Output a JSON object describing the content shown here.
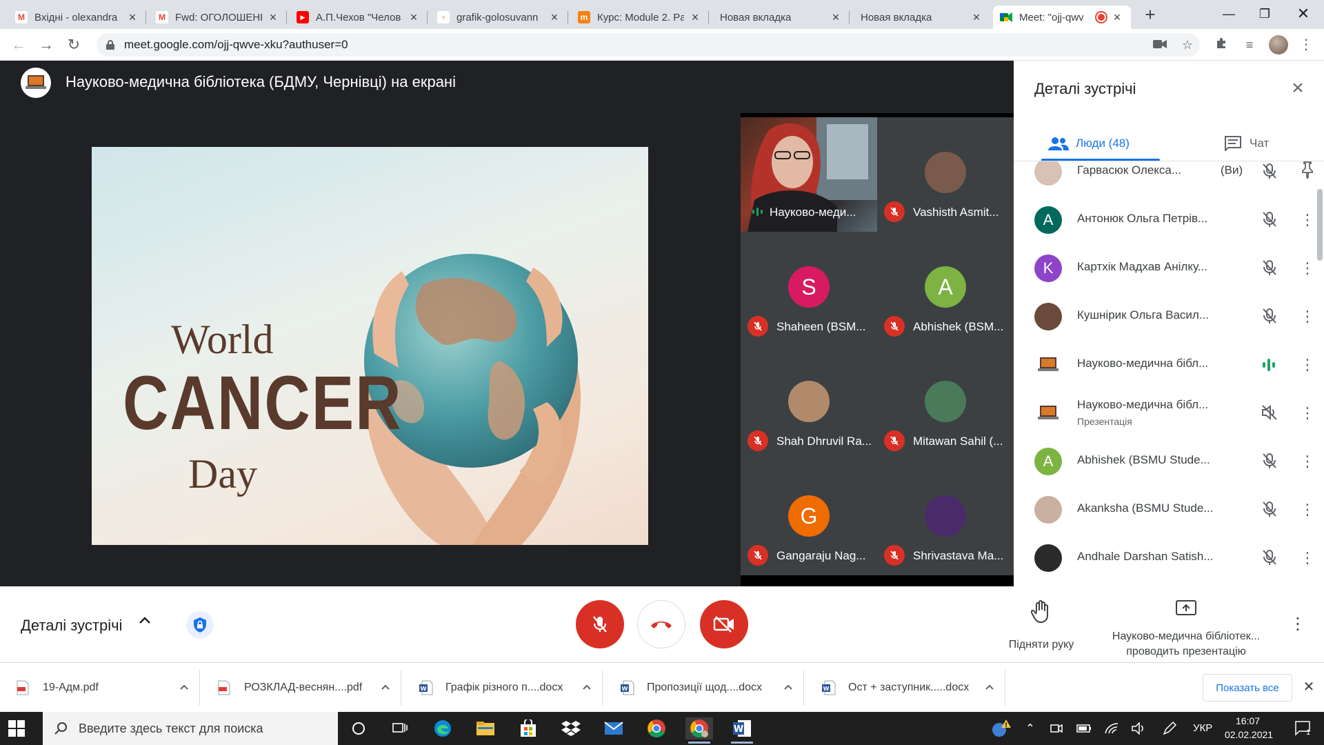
{
  "browser": {
    "tabs": [
      {
        "title": "Вхідні - olexandra",
        "favicon": "gmail-icon",
        "active": false
      },
      {
        "title": "Fwd: ОГОЛОШЕННЯ",
        "favicon": "gmail-icon",
        "active": false
      },
      {
        "title": "А.П.Чехов \"Челов",
        "favicon": "youtube-icon",
        "active": false
      },
      {
        "title": "grafik-golosuvann",
        "favicon": "trident-icon",
        "active": false
      },
      {
        "title": "Курс: Module 2. Pa",
        "favicon": "moodle-icon",
        "active": false
      },
      {
        "title": "Новая вкладка",
        "favicon": "",
        "active": false
      },
      {
        "title": "Новая вкладка",
        "favicon": "",
        "active": false
      },
      {
        "title": "Meet: \"ojj-qwv",
        "favicon": "meet-icon",
        "active": true,
        "recording": true
      }
    ],
    "url": "meet.google.com/ojj-qwve-xku?authuser=0"
  },
  "meet": {
    "presenter_title": "Науково-медична бібліотека (БДМУ, Чернівці) на екрані",
    "slide": {
      "line1": "World",
      "line2": "CANCER",
      "line3": "Day"
    },
    "tiles": [
      {
        "name": "Науково-меди...",
        "muted": false,
        "speaking": true,
        "video": true
      },
      {
        "name": "Vashisth Asmit...",
        "muted": true,
        "initial": "",
        "avatar": "photo",
        "color": "#7a5a4a"
      },
      {
        "name": "Shaheen (BSM...",
        "muted": true,
        "initial": "S",
        "color": "#d81b60"
      },
      {
        "name": "Abhishek (BSM...",
        "muted": true,
        "initial": "A",
        "color": "#7cb342"
      },
      {
        "name": "Shah Dhruvil Ra...",
        "muted": true,
        "initial": "",
        "avatar": "photo",
        "color": "#b08a6a"
      },
      {
        "name": "Mitawan Sahil (...",
        "muted": true,
        "initial": "",
        "avatar": "photo",
        "color": "#4a7a5a"
      },
      {
        "name": "Gangaraju Nag...",
        "muted": true,
        "initial": "G",
        "color": "#ef6c00"
      },
      {
        "name": "Shrivastava Ma...",
        "muted": true,
        "initial": "",
        "avatar": "photo",
        "color": "#4a2a6a"
      }
    ],
    "panel": {
      "title": "Деталі зустрічі",
      "people_tab": "Люди (48)",
      "chat_tab": "Чат",
      "people": [
        {
          "name": "Гарвасюк Олекса...",
          "suffix": "(Ви)",
          "sub": "",
          "initial": "",
          "color": "#d7c2b5",
          "mic": "muted",
          "action": "pin"
        },
        {
          "name": "Антонюк Ольга Петрів...",
          "suffix": "",
          "sub": "",
          "initial": "A",
          "color": "#00695c",
          "mic": "muted",
          "action": "more"
        },
        {
          "name": "Картхік Мадхав Анілку...",
          "suffix": "",
          "sub": "",
          "initial": "K",
          "color": "#8e44c9",
          "mic": "muted",
          "action": "more"
        },
        {
          "name": "Кушнірик Ольга Васил...",
          "suffix": "",
          "sub": "",
          "initial": "",
          "color": "#6a4a3a",
          "mic": "muted",
          "action": "more"
        },
        {
          "name": "Науково-медична бібл...",
          "suffix": "",
          "sub": "",
          "initial": "",
          "color": "#ffffff",
          "mic": "speaking",
          "action": "more"
        },
        {
          "name": "Науково-медична бібл...",
          "suffix": "",
          "sub": "Презентація",
          "initial": "",
          "color": "#ffffff",
          "mic": "presenting",
          "action": "more"
        },
        {
          "name": "Abhishek (BSMU Stude...",
          "suffix": "",
          "sub": "",
          "initial": "A",
          "color": "#7cb342",
          "mic": "muted",
          "action": "more"
        },
        {
          "name": "Akanksha (BSMU Stude...",
          "suffix": "",
          "sub": "",
          "initial": "",
          "color": "#c9b0a0",
          "mic": "muted",
          "action": "more"
        },
        {
          "name": "Andhale Darshan Satish...",
          "suffix": "",
          "sub": "",
          "initial": "",
          "color": "#2a2a2a",
          "mic": "muted",
          "action": "more"
        }
      ]
    },
    "controls": {
      "details_label": "Деталі зустрічі",
      "raise_hand": "Підняти руку",
      "present_line1": "Науково-медична бібліотек...",
      "present_line2": "проводить презентацію"
    }
  },
  "downloads": {
    "items": [
      {
        "name": "19-Адм.pdf",
        "type": "pdf"
      },
      {
        "name": "РОЗКЛАД-веснян....pdf",
        "type": "pdf"
      },
      {
        "name": "Графік різного п....docx",
        "type": "docx"
      },
      {
        "name": "Пропозиції щод....docx",
        "type": "docx"
      },
      {
        "name": "Ост + заступник.....docx",
        "type": "docx"
      }
    ],
    "show_all": "Показать все"
  },
  "taskbar": {
    "search_placeholder": "Введите здесь текст для поиска",
    "lang": "УКР",
    "time": "16:07",
    "date": "02.02.2021",
    "notifications": "1"
  },
  "colors": {
    "meet_red": "#d93025",
    "meet_blue": "#1a73e8",
    "meet_dark": "#202124",
    "speaking_teal": "#1ea362"
  }
}
